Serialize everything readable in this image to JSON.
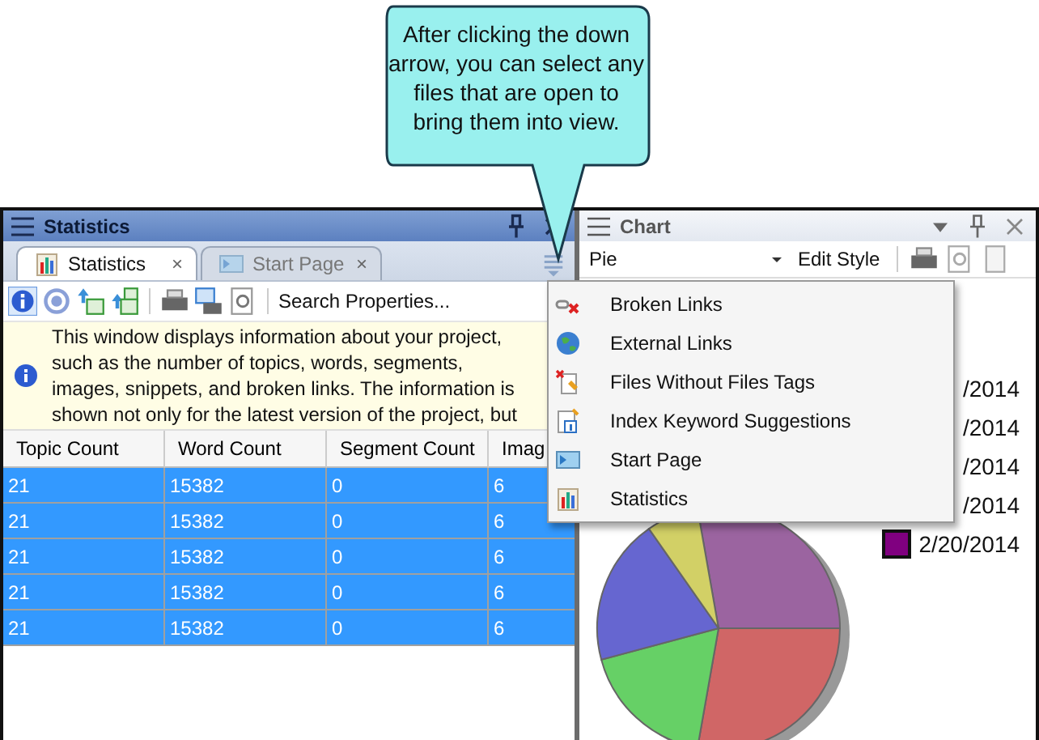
{
  "callout": {
    "text": "After clicking the down arrow, you can select any files that are open to bring them into view."
  },
  "statistics_panel": {
    "title": "Statistics",
    "tabs": [
      {
        "label": "Statistics",
        "close": "×",
        "selected": true
      },
      {
        "label": "Start Page",
        "close": "×",
        "selected": false
      }
    ],
    "toolbar": {
      "search_label": "Search Properties..."
    },
    "info": "This window displays information about your project, such as the number of topics, words, segments, images, snippets, and broken links. The information is shown not only for the latest version of the project, but",
    "table": {
      "columns": [
        "Topic Count",
        "Word Count",
        "Segment Count",
        "Imag"
      ],
      "rows": [
        {
          "cells": [
            "21",
            "15382",
            "0",
            "6"
          ],
          "selected": true
        },
        {
          "cells": [
            "21",
            "15382",
            "0",
            "6"
          ],
          "selected": true
        },
        {
          "cells": [
            "21",
            "15382",
            "0",
            "6"
          ],
          "selected": true
        },
        {
          "cells": [
            "21",
            "15382",
            "0",
            "6"
          ],
          "selected": true
        },
        {
          "cells": [
            "21",
            "15382",
            "0",
            "6"
          ],
          "selected": true
        }
      ]
    }
  },
  "chart_panel": {
    "title": "Chart",
    "chart_type": "Pie",
    "edit_style": "Edit Style",
    "legend": [
      {
        "label": "/2014"
      },
      {
        "label": "/2014"
      },
      {
        "label": "/2014"
      },
      {
        "label": "/2014"
      },
      {
        "label": "2/20/2014",
        "color": "#800080"
      }
    ]
  },
  "files_menu": {
    "items": [
      {
        "label": "Broken Links",
        "kind": "broken-links"
      },
      {
        "label": "External Links",
        "kind": "globe"
      },
      {
        "label": "Files Without Files Tags",
        "kind": "untagged"
      },
      {
        "label": "Index Keyword Suggestions",
        "kind": "index"
      },
      {
        "label": "Start Page",
        "kind": "page"
      },
      {
        "label": "Statistics",
        "kind": "chart"
      }
    ]
  }
}
